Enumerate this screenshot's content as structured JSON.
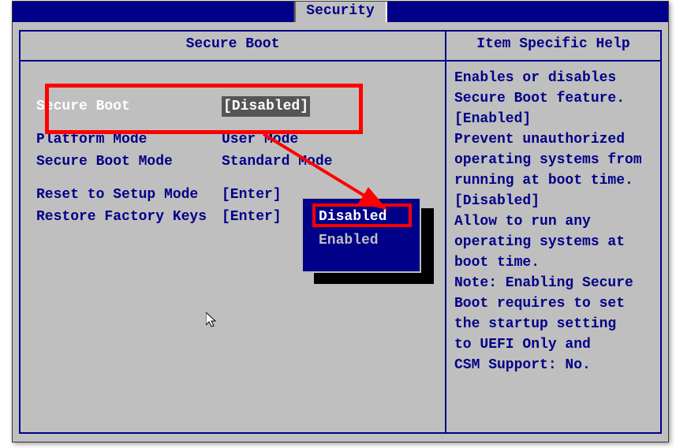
{
  "tab": {
    "label": "Security"
  },
  "panels": {
    "left_title": "Secure Boot",
    "right_title": "Item Specific Help"
  },
  "settings": {
    "secure_boot": {
      "label": "Secure Boot",
      "value": "[Disabled]"
    },
    "platform_mode": {
      "label": "Platform Mode",
      "value": "User Mode"
    },
    "secure_boot_mode": {
      "label": "Secure Boot Mode",
      "value": "Standard Mode"
    },
    "reset_setup": {
      "label": "Reset to Setup Mode",
      "value": "[Enter]"
    },
    "restore_keys": {
      "label": "Restore Factory Keys",
      "value": "[Enter]"
    }
  },
  "popup": {
    "option_disabled": "Disabled",
    "option_enabled": "Enabled"
  },
  "help": {
    "l1": "Enables or disables",
    "l2": "Secure Boot feature.",
    "l3": "[Enabled]",
    "l4": "Prevent unauthorized",
    "l5": "operating systems from",
    "l6": "running at boot time.",
    "l7": "[Disabled]",
    "l8": "Allow to run any",
    "l9": "operating systems at",
    "l10": "boot time.",
    "l11": "Note: Enabling Secure",
    "l12": "Boot requires to set",
    "l13": "the startup setting",
    "l14": "to UEFI Only and",
    "l15": "CSM Support:  No."
  },
  "colors": {
    "accent": "#000088",
    "highlight": "#ff0000"
  }
}
